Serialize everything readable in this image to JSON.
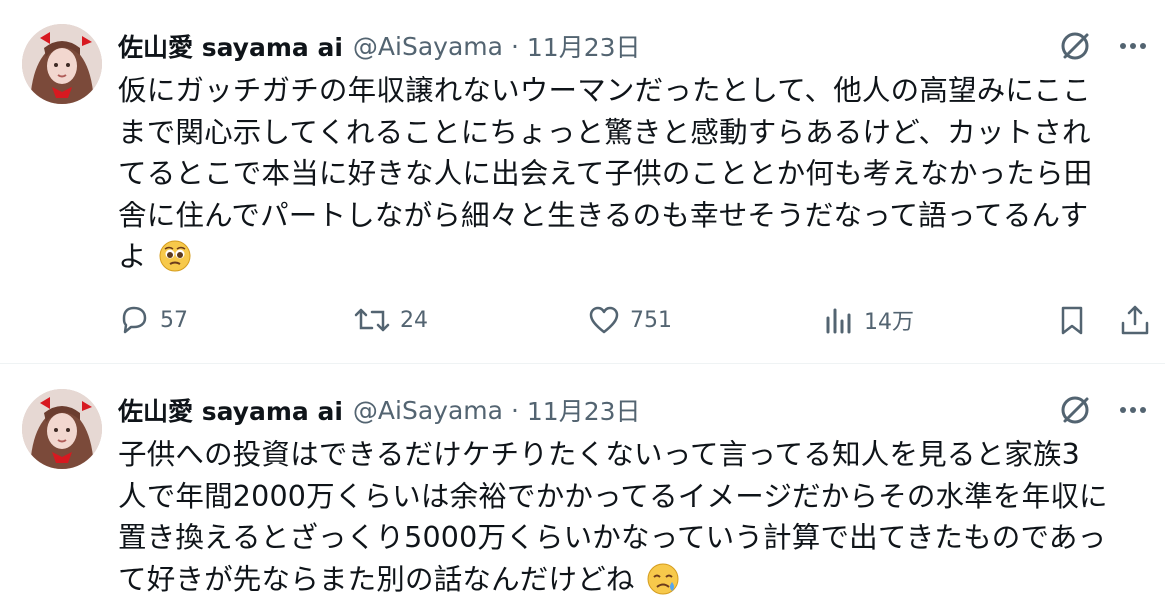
{
  "tweets": [
    {
      "name": "佐山愛 sayama ai",
      "handle": "@AiSayama",
      "separator": "·",
      "time": "11月23日",
      "lines": [
        "仮にガッチガチの年収譲れないウーマンだったとして、他人の高望みにここ",
        "まで関心示してくれることにちょっと驚きと感動すらあるけど、カットされ",
        "てるとこで本当に好きな人に出会えて子供のこととか何も考えなかったら田",
        "舎に住んでパートしながら細々と生きるのも幸せそうだなって語ってるんす",
        "よ"
      ],
      "emoji": "pleading-face",
      "metrics": {
        "replies": "57",
        "retweets": "24",
        "likes": "751",
        "views": "14万"
      }
    },
    {
      "name": "佐山愛 sayama ai",
      "handle": "@AiSayama",
      "separator": "·",
      "time": "11月23日",
      "lines": [
        "子供への投資はできるだけケチりたくないって言ってる知人を見ると家族3",
        "人で年間2000万くらいは余裕でかかってるイメージだからその水準を年収に",
        "置き換えるとざっくり5000万くらいかなっていう計算で出てきたものであっ",
        "て好きが先ならまた別の話なんだけどね"
      ],
      "emoji": "face-holding-back-tears"
    }
  ],
  "colors": {
    "text": "#0f1419",
    "muted": "#536471",
    "border": "#eff3f4",
    "avatar_bg": "#d9c7c2"
  },
  "icons": [
    "grok-icon",
    "more-icon",
    "reply-icon",
    "retweet-icon",
    "like-icon",
    "views-icon",
    "bookmark-icon",
    "share-icon"
  ]
}
